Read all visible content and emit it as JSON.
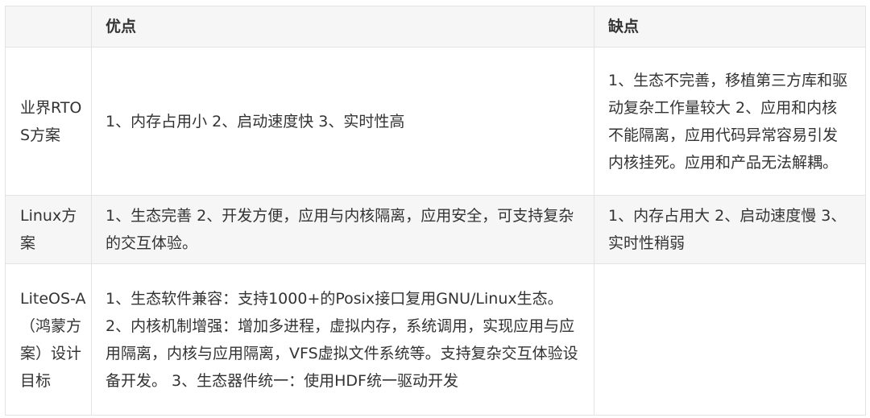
{
  "table": {
    "headers": [
      "",
      "优点",
      "缺点"
    ],
    "rows": [
      {
        "label": "业界RTOS方案",
        "pros": "1、内存占用小 2、启动速度快 3、实时性高",
        "cons": "1、生态不完善，移植第三方库和驱动复杂工作量较大 2、应用和内核不能隔离，应用代码异常容易引发内核挂死。应用和产品无法解耦。"
      },
      {
        "label": "Linux方案",
        "pros": "1、生态完善 2、开发方便，应用与内核隔离，应用安全，可支持复杂的交互体验。",
        "cons": "1、内存占用大 2、启动速度慢 3、实时性稍弱"
      },
      {
        "label": "LiteOS-A（鸿蒙方案）设计目标",
        "pros": "1、生态软件兼容：支持1000+的Posix接口复用GNU/Linux生态。 2、内核机制增强：增加多进程，虚拟内存，系统调用，实现应用与应用隔离，内核与应用隔离，VFS虚拟文件系统等。支持复杂交互体验设备开发。 3、生态器件统一：使用HDF统一驱动开发",
        "cons": ""
      }
    ]
  }
}
